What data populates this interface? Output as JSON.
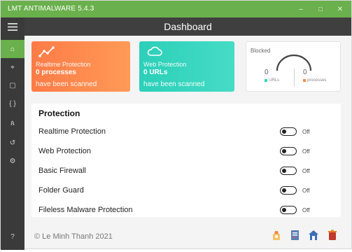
{
  "window": {
    "title": "LMT ANTIMALWARE 5.4.3",
    "controls": {
      "minimize": "–",
      "maximize": "□",
      "close": "✕"
    },
    "accent_color": "#6ab04c"
  },
  "header": {
    "title": "Dashboard"
  },
  "sidebar": {
    "menu_icon": "hamburger-menu-icon",
    "items": [
      {
        "icon": "home-icon",
        "glyph": "⌂",
        "active": true
      },
      {
        "icon": "network-icon",
        "glyph": "⌖",
        "active": false
      },
      {
        "icon": "document-icon",
        "glyph": "▢",
        "active": false
      },
      {
        "icon": "code-braces-icon",
        "glyph": "{ }",
        "active": false
      },
      {
        "icon": "user-key-icon",
        "glyph": "ጰ",
        "active": false
      },
      {
        "icon": "history-icon",
        "glyph": "↺",
        "active": false
      },
      {
        "icon": "settings-gear-icon",
        "glyph": "⚙",
        "active": false
      }
    ],
    "help": "?"
  },
  "cards": {
    "realtime": {
      "label": "Realtime Protection",
      "value": "0 processes",
      "caption": "have been scanned",
      "icon": "realtime-line-icon",
      "color": "#ff8a4c"
    },
    "web": {
      "label": "Web Protection",
      "value": "0 URLs",
      "caption": "have been scanned",
      "icon": "cloud-icon",
      "color": "#35d3bd"
    }
  },
  "blocked": {
    "title": "Blocked",
    "urls_value": "0",
    "urls_label": "URLs",
    "urls_color": "#35d3bd",
    "processes_value": "0",
    "processes_label": "processes",
    "processes_color": "#ff8a4c"
  },
  "protection": {
    "title": "Protection",
    "items": [
      {
        "label": "Realtime Protection",
        "state": "Off"
      },
      {
        "label": "Web Protection",
        "state": "Off"
      },
      {
        "label": "Basic Firewall",
        "state": "Off"
      },
      {
        "label": "Folder Guard",
        "state": "Off"
      },
      {
        "label": "Fileless Malware Protection",
        "state": "Off"
      }
    ]
  },
  "footer": {
    "copyright": "© Le Minh Thanh 2021",
    "icons": [
      "clean-icon",
      "report-icon",
      "home-shield-icon",
      "trash-icon"
    ]
  }
}
